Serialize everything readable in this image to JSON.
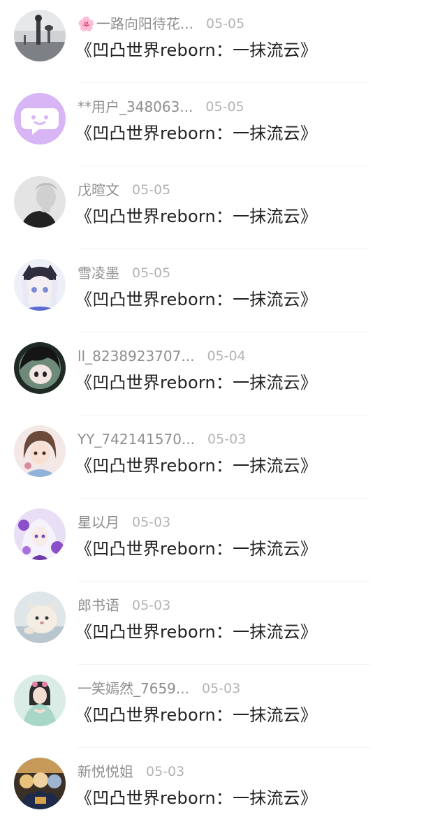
{
  "comments": [
    {
      "flower": "🌸",
      "name": "一路向阳待花...",
      "date": "05-05",
      "title": "《凹凸世界reborn：一抹流云》",
      "avatar": "avatar-photo-gray"
    },
    {
      "flower": "",
      "name": "**用户_348063...",
      "date": "05-05",
      "title": "《凹凸世界reborn：一抹流云》",
      "avatar": "avatar-default-chat"
    },
    {
      "flower": "",
      "name": "戊暄文",
      "date": "05-05",
      "title": "《凹凸世界reborn：一抹流云》",
      "avatar": "avatar-photo-bw"
    },
    {
      "flower": "",
      "name": "雪凌墨",
      "date": "05-05",
      "title": "《凹凸世界reborn：一抹流云》",
      "avatar": "avatar-anime-catgirl"
    },
    {
      "flower": "",
      "name": "ll_8238923707...",
      "date": "05-04",
      "title": "《凹凸世界reborn：一抹流云》",
      "avatar": "avatar-anime-dark"
    },
    {
      "flower": "",
      "name": "YY_742141570...",
      "date": "05-03",
      "title": "《凹凸世界reborn：一抹流云》",
      "avatar": "avatar-anime-girl"
    },
    {
      "flower": "",
      "name": "星以月",
      "date": "05-03",
      "title": "《凹凸世界reborn：一抹流云》",
      "avatar": "avatar-anime-purple"
    },
    {
      "flower": "",
      "name": "郎书语",
      "date": "05-03",
      "title": "《凹凸世界reborn：一抹流云》",
      "avatar": "avatar-photo-cat"
    },
    {
      "flower": "",
      "name": "一笑嫣然_7659...",
      "date": "05-03",
      "title": "《凹凸世界reborn：一抹流云》",
      "avatar": "avatar-photo-girl"
    },
    {
      "flower": "",
      "name": "新悦悦姐",
      "date": "05-03",
      "title": "《凹凸世界reborn：一抹流云》",
      "avatar": "avatar-anime-group"
    }
  ],
  "colors": {
    "name": "#8e8e8e",
    "date": "#b3b3b3",
    "title": "#222222",
    "default_avatar_bg": "#d8b6f5"
  }
}
